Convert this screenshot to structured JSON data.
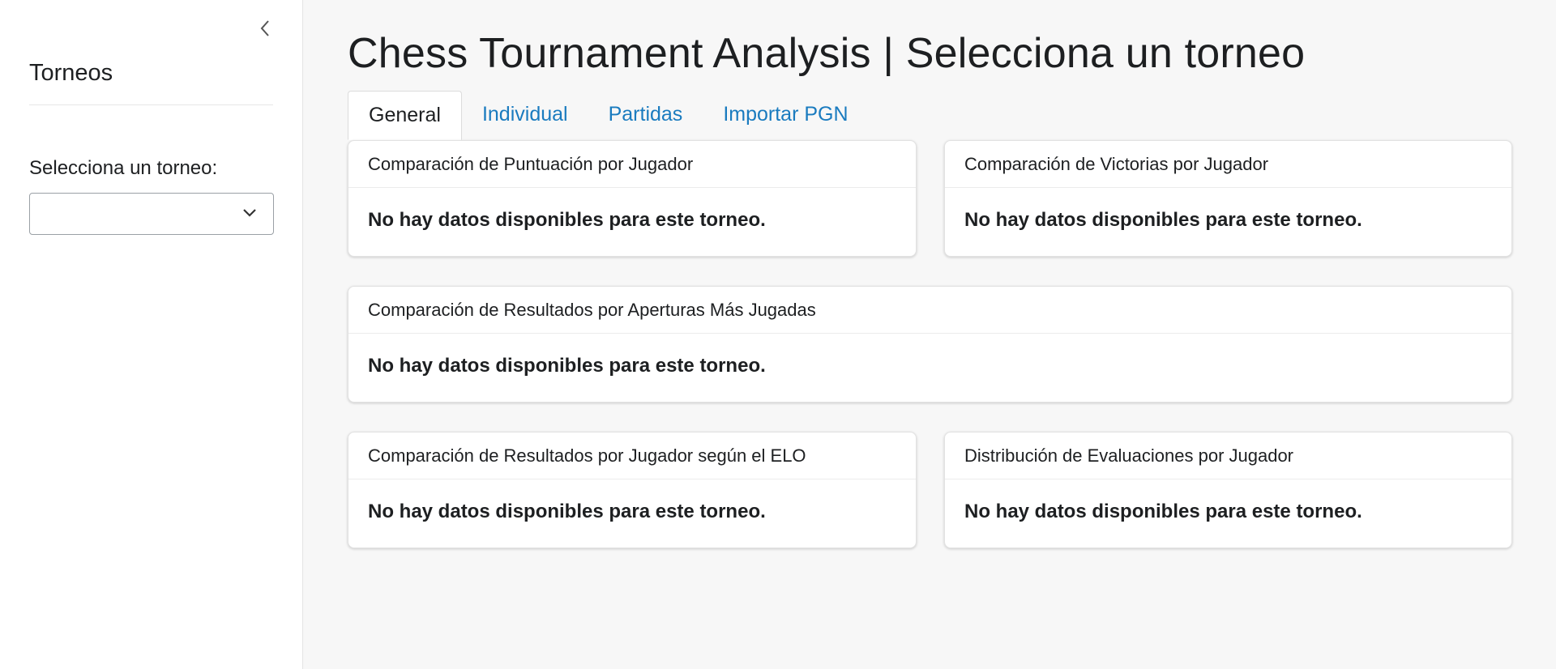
{
  "sidebar": {
    "collapse_icon": "chevron-left-icon",
    "title": "Torneos",
    "select_label": "Selecciona un torneo:",
    "select_value": "",
    "select_icon": "chevron-down-icon"
  },
  "main": {
    "title": "Chess Tournament Analysis | Selecciona un torneo",
    "tabs": [
      {
        "label": "General",
        "active": true
      },
      {
        "label": "Individual",
        "active": false
      },
      {
        "label": "Partidas",
        "active": false
      },
      {
        "label": "Importar PGN",
        "active": false
      }
    ],
    "cards": [
      {
        "title": "Comparación de Puntuación por Jugador",
        "message": "No hay datos disponibles para este torneo."
      },
      {
        "title": "Comparación de Victorias por Jugador",
        "message": "No hay datos disponibles para este torneo."
      },
      {
        "title": "Comparación de Resultados por Aperturas Más Jugadas",
        "message": "No hay datos disponibles para este torneo."
      },
      {
        "title": "Comparación de Resultados por Jugador según el ELO",
        "message": "No hay datos disponibles para este torneo."
      },
      {
        "title": "Distribución de Evaluaciones por Jugador",
        "message": "No hay datos disponibles para este torneo."
      }
    ]
  },
  "colors": {
    "accent_link": "#1a7bbf",
    "text": "#1d1f21",
    "page_bg": "#f7f7f7"
  }
}
